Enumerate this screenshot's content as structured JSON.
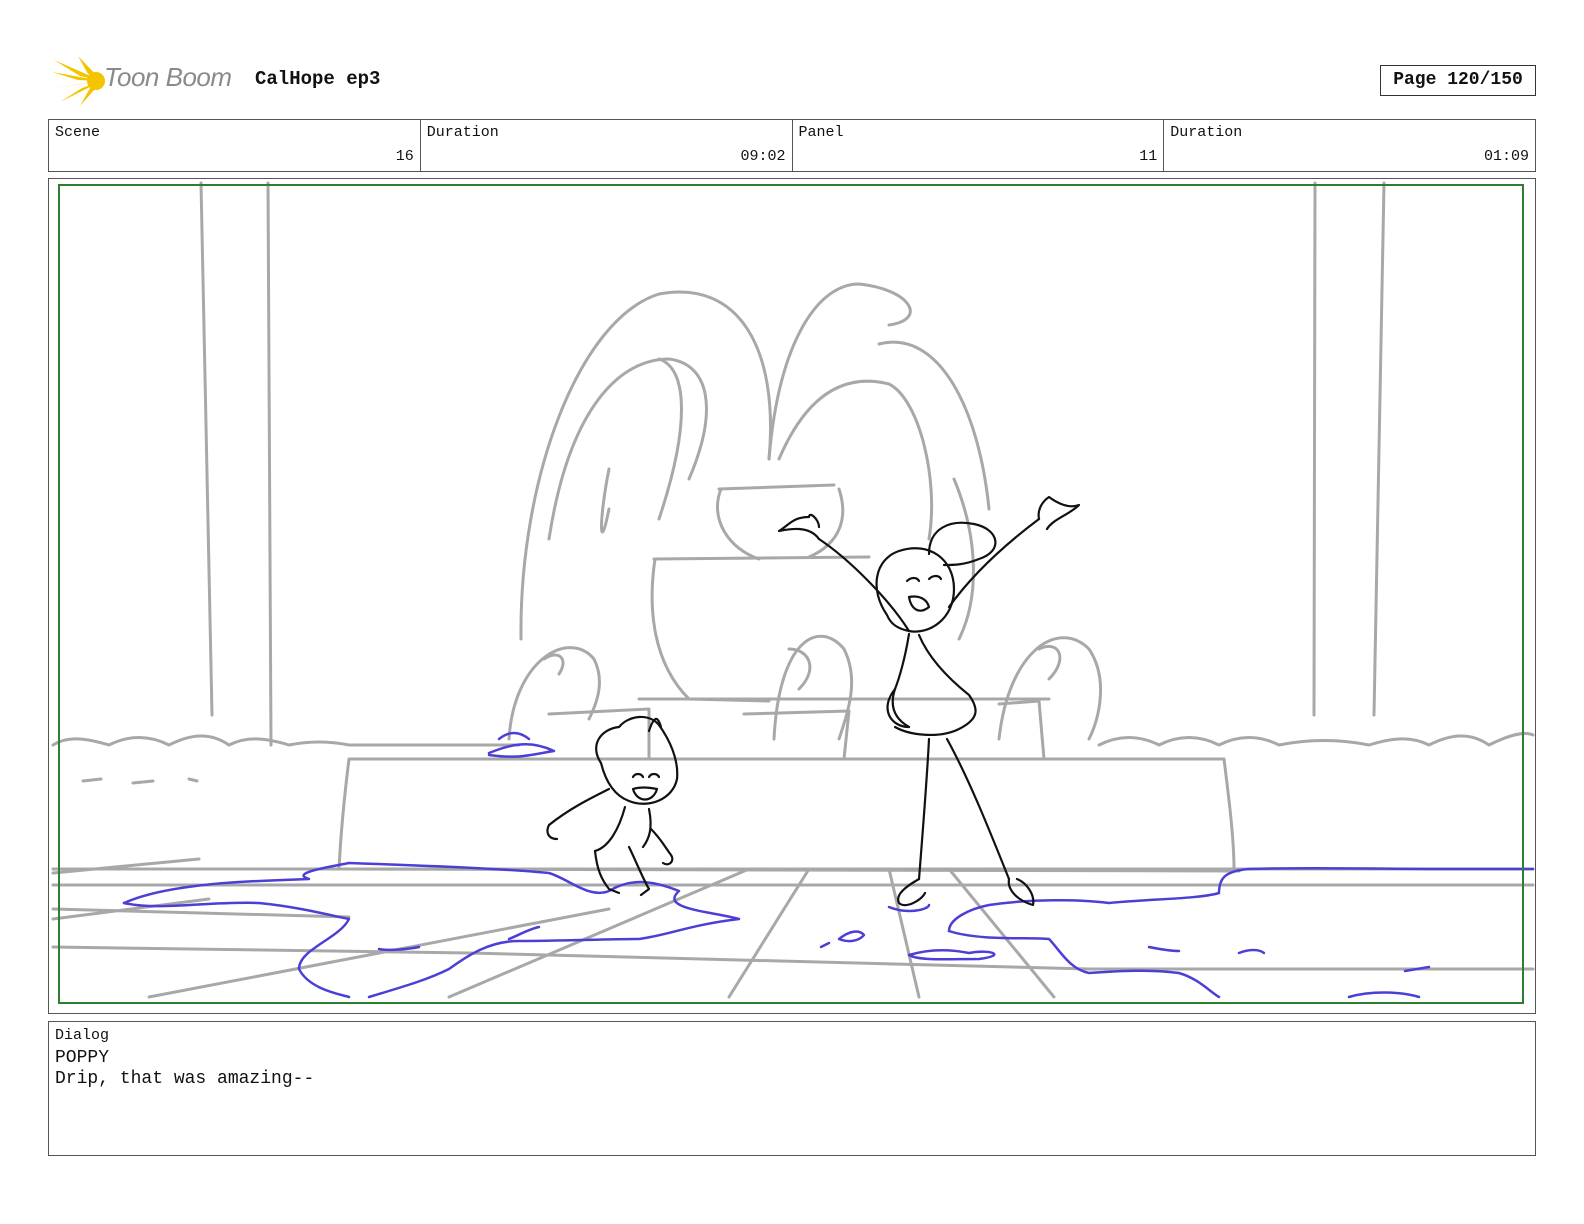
{
  "header": {
    "logo_text": "Toon Boom",
    "project_title": "CalHope ep3",
    "page_indicator": "Page 120/150"
  },
  "info": {
    "scene_label": "Scene",
    "scene_value": "16",
    "scene_duration_label": "Duration",
    "scene_duration_value": "09:02",
    "panel_label": "Panel",
    "panel_value": "11",
    "panel_duration_label": "Duration",
    "panel_duration_value": "01:09"
  },
  "dialog": {
    "label": "Dialog",
    "speaker": "POPPY",
    "line": "Drip, that was amazing--"
  },
  "colors": {
    "safe_frame": "#2e7d32",
    "background_sketch": "#a8a8a8",
    "water": "#4b3fd6",
    "character_ink": "#111111",
    "logo_burst": "#f5c400"
  }
}
